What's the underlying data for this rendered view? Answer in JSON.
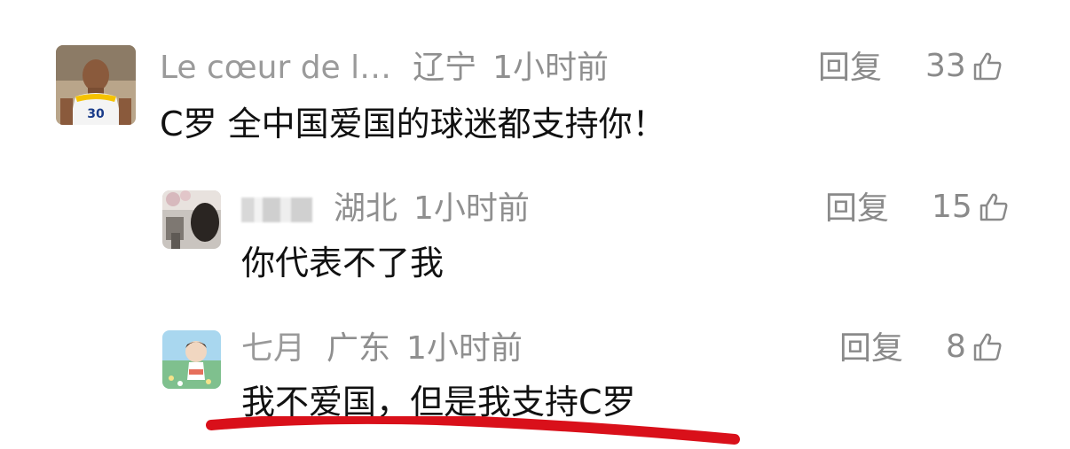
{
  "comments": [
    {
      "name": "Le cœur de l…",
      "region": "辽宁",
      "time": "1小时前",
      "text": "C罗 全中国爱国的球迷都支持你！",
      "reply_label": "回复",
      "likes": "33"
    },
    {
      "name": "",
      "region": "湖北",
      "time": "1小时前",
      "text": "你代表不了我",
      "reply_label": "回复",
      "likes": "15"
    },
    {
      "name": "七月",
      "region": "广东",
      "time": "1小时前",
      "text": "我不爱国，但是我支持C罗",
      "reply_label": "回复",
      "likes": "8"
    }
  ],
  "colors": {
    "underline": "#d9101a",
    "meta_text": "#8f8f8f",
    "body_text": "#111111"
  },
  "icons": {
    "like": "thumbs-up-icon"
  }
}
